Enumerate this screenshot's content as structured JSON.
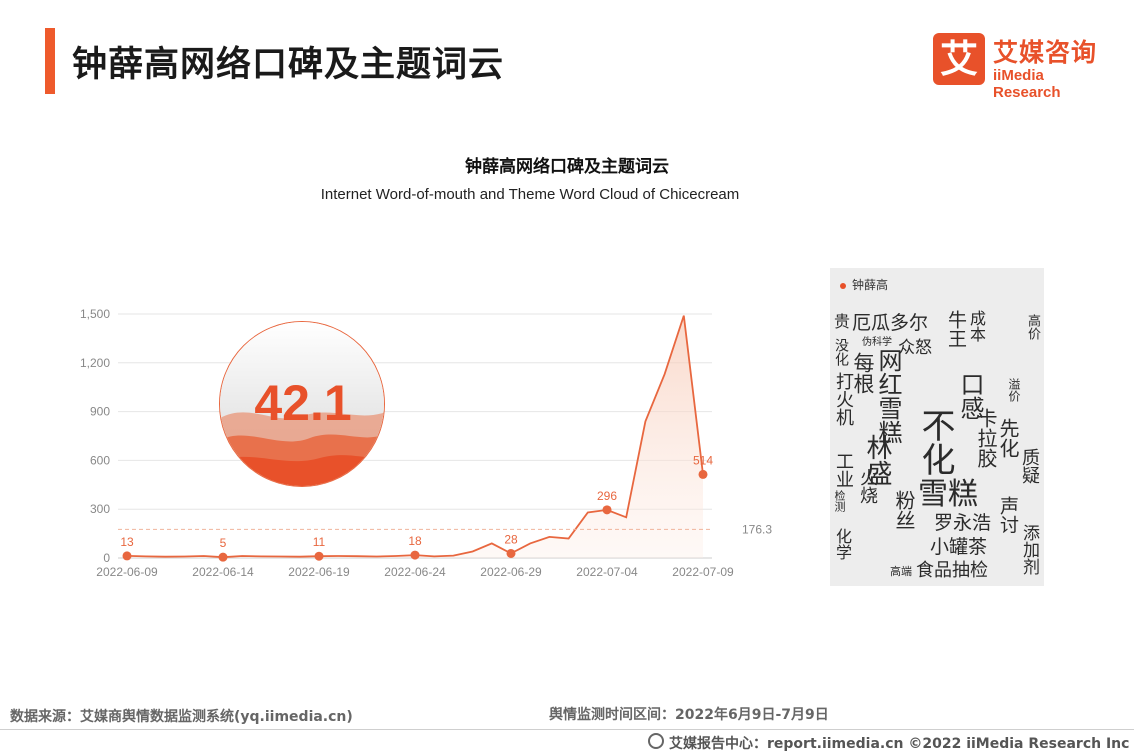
{
  "header": {
    "title": "钟薛高网络口碑及主题词云",
    "logo_mark": "艾",
    "logo_cn": "艾媒咨询",
    "logo_en": "iiMedia Research"
  },
  "chart_titles": {
    "title": "钟薛高网络口碑及主题词云",
    "subtitle": "Internet Word-of-mouth and Theme Word Cloud of Chicecream"
  },
  "gauge": {
    "value": "42.1",
    "color": "#e8512a"
  },
  "chart_data": [
    {
      "type": "line",
      "x": [
        "2022-06-09",
        "2022-06-10",
        "2022-06-11",
        "2022-06-12",
        "2022-06-13",
        "2022-06-14",
        "2022-06-15",
        "2022-06-16",
        "2022-06-17",
        "2022-06-18",
        "2022-06-19",
        "2022-06-20",
        "2022-06-21",
        "2022-06-22",
        "2022-06-23",
        "2022-06-24",
        "2022-06-25",
        "2022-06-26",
        "2022-06-27",
        "2022-06-28",
        "2022-06-29",
        "2022-06-30",
        "2022-07-01",
        "2022-07-02",
        "2022-07-03",
        "2022-07-04",
        "2022-07-05",
        "2022-07-06",
        "2022-07-07",
        "2022-07-08",
        "2022-07-09"
      ],
      "values": [
        13,
        10,
        8,
        9,
        12,
        5,
        12,
        10,
        9,
        8,
        11,
        12,
        11,
        9,
        12,
        18,
        10,
        15,
        40,
        90,
        28,
        90,
        130,
        120,
        280,
        296,
        250,
        840,
        1130,
        1490,
        514
      ],
      "x_tick_labels": [
        "2022-06-09",
        "2022-06-14",
        "2022-06-19",
        "2022-06-24",
        "2022-06-29",
        "2022-07-04",
        "2022-07-09"
      ],
      "y_tick_labels": [
        "0",
        "300",
        "600",
        "900",
        "1,200",
        "1,500"
      ],
      "ylim": [
        0,
        1500
      ],
      "labeled_points": [
        {
          "x": "2022-06-09",
          "label": "13"
        },
        {
          "x": "2022-06-14",
          "label": "5"
        },
        {
          "x": "2022-06-19",
          "label": "11"
        },
        {
          "x": "2022-06-24",
          "label": "18"
        },
        {
          "x": "2022-06-29",
          "label": "28"
        },
        {
          "x": "2022-07-04",
          "label": "296"
        },
        {
          "x": "2022-07-09",
          "label": "514"
        }
      ],
      "markline": {
        "value": 176.3,
        "label": "176.3"
      },
      "color": "#e8673f",
      "grid": true
    }
  ],
  "wordcloud": {
    "legend": "钟薛高",
    "words": [
      "贵",
      "厄瓜多尔",
      "牛王",
      "成本",
      "高价",
      "伪科学",
      "没化",
      "每根",
      "众怒",
      "网红雪糕",
      "不化",
      "雪糕",
      "口感",
      "林盛",
      "火烧",
      "打火机",
      "粉丝",
      "化学",
      "罗永浩",
      "小罐茶",
      "声讨",
      "添加剂",
      "质疑",
      "食品抽检",
      "先化",
      "卡拉胶",
      "高端",
      "工业",
      "检测",
      "溢价"
    ]
  },
  "footer": {
    "source": "数据来源：艾媒商舆情数据监测系统(yq.iimedia.cn)",
    "period": "舆情监测时间区间：2022年6月9日-7月9日",
    "report": "艾媒报告中心：report.iimedia.cn ©2022 iiMedia Research Inc"
  }
}
